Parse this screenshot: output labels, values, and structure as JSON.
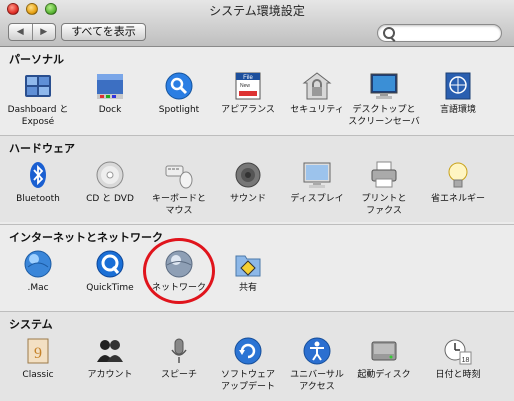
{
  "window": {
    "title": "システム環境設定"
  },
  "toolbar": {
    "back_glyph": "◀",
    "forward_glyph": "▶",
    "show_all": "すべてを表示",
    "search_value": "",
    "search_placeholder": ""
  },
  "sections": [
    {
      "title": "パーソナル",
      "items": [
        {
          "label": "Dashboard と\nExposé",
          "icon": "dashboard-icon"
        },
        {
          "label": "Dock",
          "icon": "dock-icon"
        },
        {
          "label": "Spotlight",
          "icon": "spotlight-icon"
        },
        {
          "label": "アピアランス",
          "icon": "appearance-icon"
        },
        {
          "label": "セキュリティ",
          "icon": "security-icon"
        },
        {
          "label": "デスクトップと\nスクリーンセーバ",
          "icon": "desktop-icon"
        },
        {
          "label": "言語環境",
          "icon": "international-icon"
        }
      ]
    },
    {
      "title": "ハードウェア",
      "items": [
        {
          "label": "Bluetooth",
          "icon": "bluetooth-icon"
        },
        {
          "label": "CD と DVD",
          "icon": "cd-dvd-icon"
        },
        {
          "label": "キーボードと\nマウス",
          "icon": "keyboard-mouse-icon"
        },
        {
          "label": "サウンド",
          "icon": "sound-icon"
        },
        {
          "label": "ディスプレイ",
          "icon": "display-icon"
        },
        {
          "label": "プリントと\nファクス",
          "icon": "print-fax-icon"
        },
        {
          "label": "省エネルギー",
          "icon": "energy-saver-icon"
        }
      ]
    },
    {
      "title": "インターネットとネットワーク",
      "items": [
        {
          "label": ".Mac",
          "icon": "mac-icon"
        },
        {
          "label": "QuickTime",
          "icon": "quicktime-icon"
        },
        {
          "label": "ネットワーク",
          "icon": "network-icon"
        },
        {
          "label": "共有",
          "icon": "sharing-icon"
        }
      ]
    },
    {
      "title": "システム",
      "items": [
        {
          "label": "Classic",
          "icon": "classic-icon"
        },
        {
          "label": "アカウント",
          "icon": "accounts-icon"
        },
        {
          "label": "スピーチ",
          "icon": "speech-icon"
        },
        {
          "label": "ソフトウェア\nアップデート",
          "icon": "software-update-icon"
        },
        {
          "label": "ユニバーサル\nアクセス",
          "icon": "universal-access-icon"
        },
        {
          "label": "起動ディスク",
          "icon": "startup-disk-icon"
        },
        {
          "label": "日付と時刻",
          "icon": "date-time-icon"
        }
      ]
    }
  ],
  "icon_text": {
    "appearance_file": "File",
    "appearance_new": "New",
    "date_day": "18"
  },
  "colors": {
    "highlight_circle": "#e0141c"
  }
}
